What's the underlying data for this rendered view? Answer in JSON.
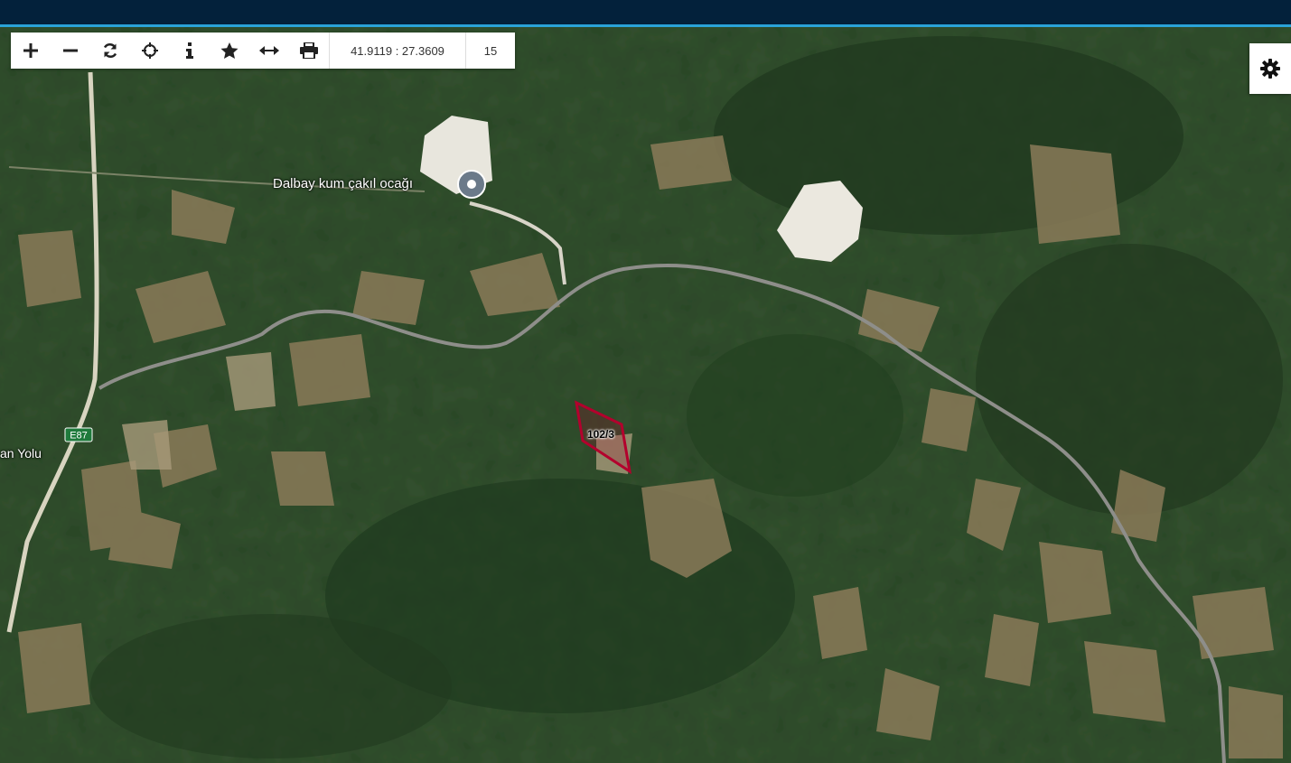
{
  "toolbar": {
    "buttons": [
      "zoom-in",
      "zoom-out",
      "refresh",
      "locate",
      "info",
      "favorite",
      "measure",
      "print"
    ],
    "coordinates": "41.9119 : 27.3609",
    "zoom_level": "15"
  },
  "settings": {
    "icon": "gear-icon"
  },
  "map": {
    "place_label": "Dalbay kum çakıl ocağı",
    "parcel_label": "102/3",
    "road_shield": "E87",
    "road_name_partial": "an Yolu",
    "parcel_color": "#b3002d",
    "header_color": "#03213b",
    "accent_color": "#2aa3d8"
  }
}
